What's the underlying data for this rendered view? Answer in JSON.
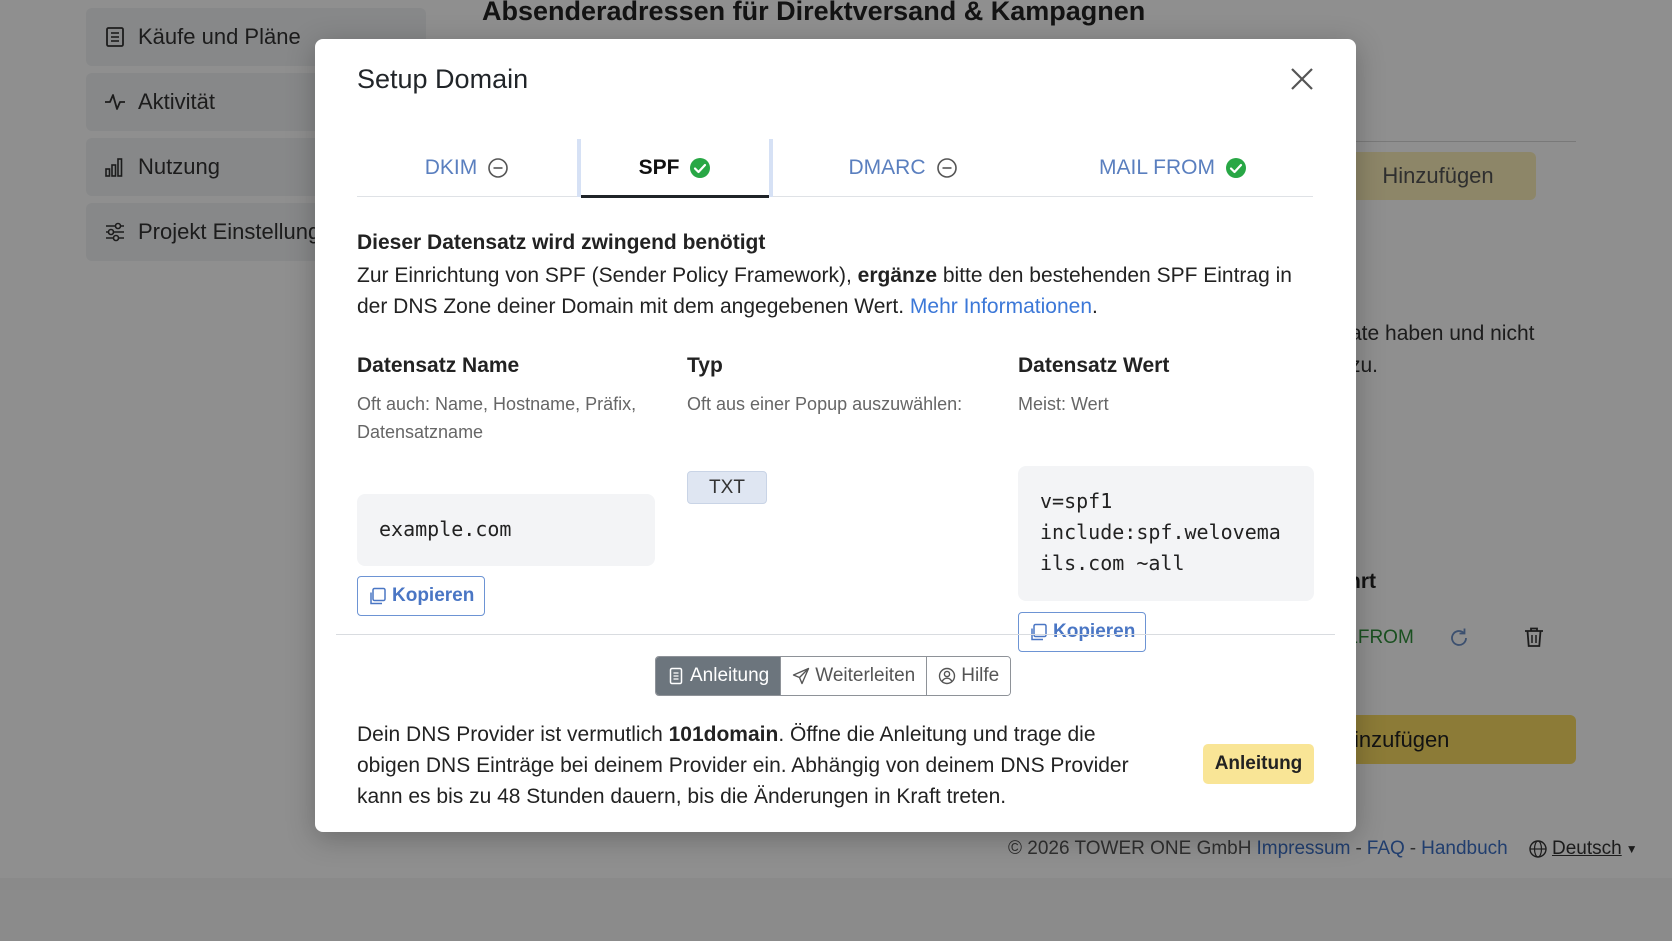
{
  "background": {
    "sidebar": [
      {
        "label": "Käufe und Pläne",
        "icon": "receipt-icon"
      },
      {
        "label": "Aktivität",
        "icon": "activity-icon"
      },
      {
        "label": "Nutzung",
        "icon": "bar-chart-icon"
      },
      {
        "label": "Projekt Einstellungen",
        "icon": "sliders-icon"
      }
    ],
    "page_title": "Absenderadressen für Direktversand & Kampagnen",
    "add_button_label": "Hinzufügen",
    "partial_text_line1": "ate haben und nicht",
    "partial_text_line2": "zu.",
    "column_header_partial": "hrt",
    "row_type_partial": "ILFROM",
    "add_button2_label": "inzufügen",
    "footer": {
      "copyright": "© 2026 TOWER ONE GmbH",
      "impressum": "Impressum",
      "faq": "FAQ",
      "handbuch": "Handbuch",
      "separator": "-",
      "language": "Deutsch"
    }
  },
  "modal": {
    "title": "Setup Domain",
    "tabs": [
      {
        "label": "DKIM",
        "status": "pending"
      },
      {
        "label": "SPF",
        "status": "ok",
        "active": true
      },
      {
        "label": "DMARC",
        "status": "pending"
      },
      {
        "label": "MAIL FROM",
        "status": "ok"
      }
    ],
    "required_title": "Dieser Datensatz wird zwingend benötigt",
    "description": {
      "part1": "Zur Einrichtung von SPF (Sender Policy Framework), ",
      "bold": "ergänze",
      "part2": " bitte den bestehenden SPF Eintrag in der DNS Zone deiner Domain mit dem angegebenen Wert. ",
      "link": "Mehr Informationen",
      "end": "."
    },
    "columns": {
      "name": {
        "header": "Datensatz Name",
        "hint": "Oft auch: Name, Hostname, Präfix, Datensatzname",
        "value": "example.com",
        "copy_label": "Kopieren"
      },
      "type": {
        "header": "Typ",
        "hint": "Oft aus einer Popup auszuwählen:",
        "value": "TXT"
      },
      "value": {
        "header": "Datensatz Wert",
        "hint": "Meist: Wert",
        "line1": "v=spf1",
        "line2": "include:spf.welovema",
        "line3": "ils.com ~all",
        "copy_label": "Kopieren"
      }
    },
    "segments": [
      {
        "label": "Anleitung",
        "active": true
      },
      {
        "label": "Weiterleiten",
        "active": false
      },
      {
        "label": "Hilfe",
        "active": false
      }
    ],
    "provider": {
      "part1": "Dein DNS Provider ist vermutlich ",
      "name": "101domain",
      "part2": ". Öffne die Anleitung und trage die obigen DNS Einträge bei deinem Provider ein. Abhängig von deinem DNS Provider kann es bis zu 48 Stunden dauern, bis die Änderungen in Kraft treten."
    },
    "guide_button_label": "Anleitung"
  },
  "colors": {
    "link": "#3c78d8",
    "ok": "#28a745",
    "guide_button": "#f9e596",
    "overlay": "rgba(0,0,0,0.44)"
  }
}
